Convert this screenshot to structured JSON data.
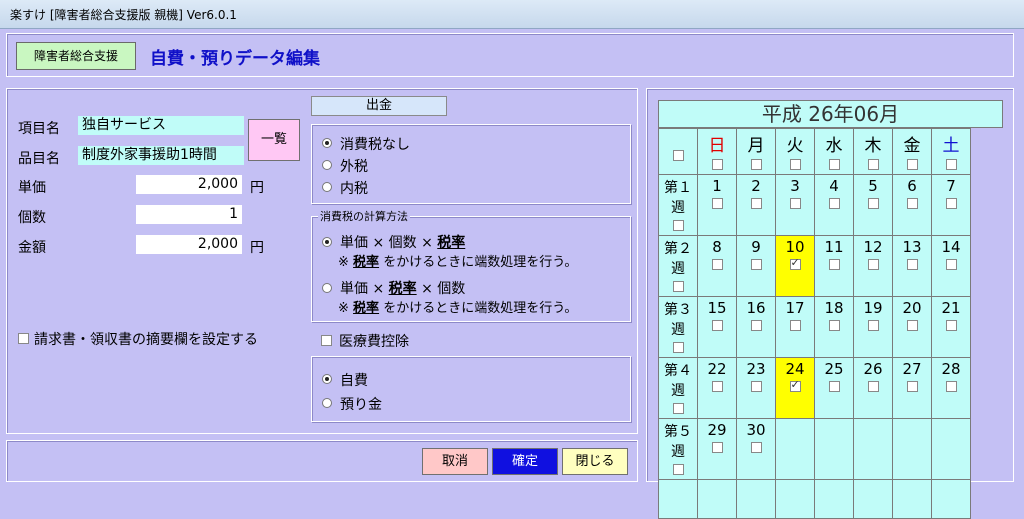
{
  "window": {
    "title": "楽すけ [障害者総合支援版 親機] Ver6.0.1"
  },
  "header": {
    "tag": "障害者総合支援",
    "title": "自費・預りデータ編集"
  },
  "form": {
    "item_name_label": "項目名",
    "item_name_value": "独自サービス",
    "product_name_label": "品目名",
    "product_name_value": "制度外家事援助1時間",
    "list_button": "一覧",
    "unit_price_label": "単価",
    "unit_price_value": "2,000",
    "quantity_label": "個数",
    "quantity_value": "1",
    "amount_label": "金額",
    "amount_value": "2,000",
    "yen": "円",
    "invoice_checkbox_label": "請求書・領収書の摘要欄を設定する"
  },
  "tax": {
    "section_title": "出金",
    "options": [
      "消費税なし",
      "外税",
      "内税"
    ],
    "selected": 0,
    "calc_title": "消費税の計算方法",
    "calc_option1_a": "単価 × 個数 × ",
    "calc_option1_b": "税率",
    "calc_note_mark": "※",
    "calc_note_bold": "税率",
    "calc_note_rest": "をかけるときに端数処理を行う。",
    "calc_option2_a": "単価 × ",
    "calc_option2_b": "税率",
    "calc_option2_c": " × 個数",
    "medical_label": "医療費控除",
    "type_options": [
      "自費",
      "預り金"
    ],
    "type_selected": 0
  },
  "buttons": {
    "cancel": "取消",
    "confirm": "確定",
    "close": "閉じる"
  },
  "calendar": {
    "title": "平成 26年06月",
    "weekdays": [
      "日",
      "月",
      "火",
      "水",
      "木",
      "金",
      "土"
    ],
    "weeks": [
      {
        "label": "第１週",
        "days": [
          "",
          "",
          "",
          "",
          "",
          "",
          ""
        ]
      },
      {
        "label": "第２週",
        "days": [
          "",
          "",
          "",
          "",
          "",
          "",
          ""
        ]
      },
      {
        "label": "第３週",
        "days": [
          "",
          "",
          "",
          "",
          "",
          "",
          ""
        ]
      },
      {
        "label": "第４週",
        "days": [
          "",
          "",
          "",
          "",
          "",
          "",
          ""
        ]
      },
      {
        "label": "第５週",
        "days": [
          "",
          "",
          "",
          "",
          "",
          "",
          ""
        ]
      }
    ],
    "dates": [
      [
        "1",
        "2",
        "3",
        "4",
        "5",
        "6",
        "7"
      ],
      [
        "8",
        "9",
        "10",
        "11",
        "12",
        "13",
        "14"
      ],
      [
        "15",
        "16",
        "17",
        "18",
        "19",
        "20",
        "21"
      ],
      [
        "22",
        "23",
        "24",
        "25",
        "26",
        "27",
        "28"
      ],
      [
        "29",
        "30",
        "",
        "",
        "",
        "",
        ""
      ]
    ],
    "highlighted": [
      "10",
      "24"
    ],
    "colors": {
      "sunday": "#e00000",
      "saturday": "#1010d0"
    }
  }
}
